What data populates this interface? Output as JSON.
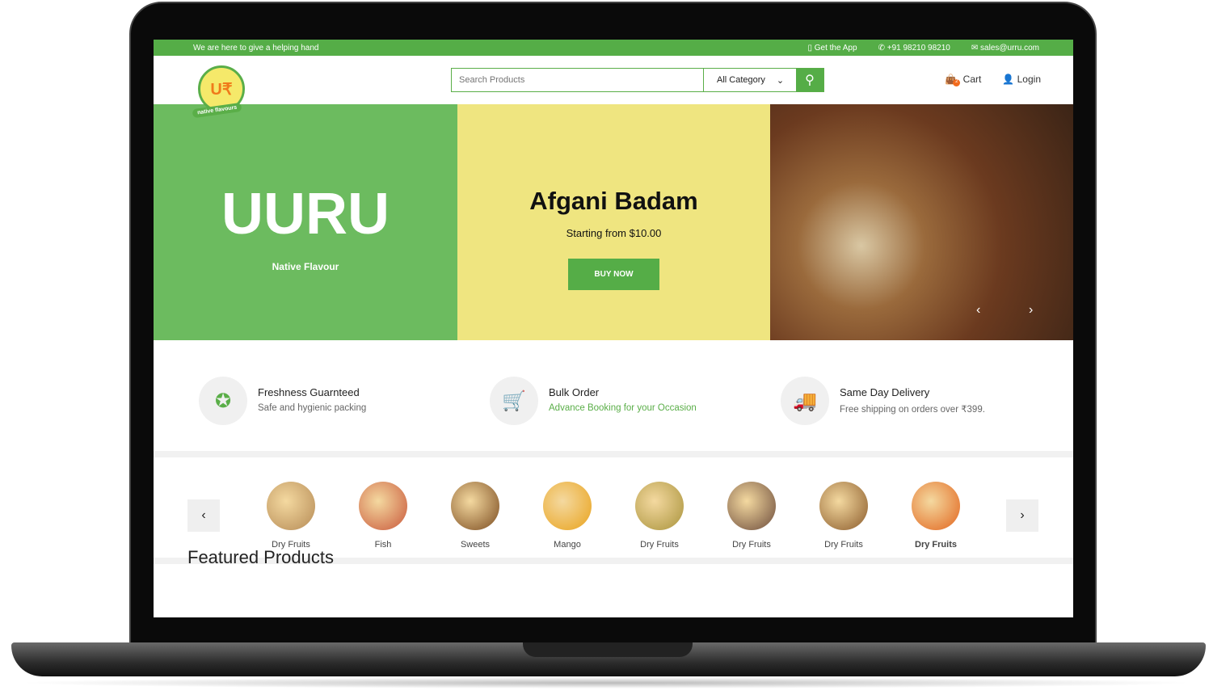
{
  "topbar": {
    "tagline": "We are here to give a helping hand",
    "app": "Get the App",
    "phone": "+91 98210 98210",
    "email": "sales@urru.com"
  },
  "header": {
    "logo_text": "U₹",
    "logo_tagline": "native flavours",
    "search_placeholder": "Search Products",
    "category": "All Category",
    "cart": "Cart",
    "cart_count": "2",
    "login": "Login"
  },
  "hero": {
    "brand": "UURU",
    "brand_sub": "Native Flavour",
    "title": "Afgani Badam",
    "subtitle": "Starting from  $10.00",
    "cta": "BUY NOW"
  },
  "features": [
    {
      "title": "Freshness Guarnteed",
      "desc": "Safe and hygienic packing"
    },
    {
      "title": "Bulk Order",
      "desc": "Advance Booking for your Occasion"
    },
    {
      "title": "Same Day Delivery",
      "desc": "Free shipping on orders over ₹399."
    }
  ],
  "categories": [
    {
      "label": "Dry Fruits",
      "color": "#b58a55"
    },
    {
      "label": "Fish",
      "color": "#c9573a"
    },
    {
      "label": "Sweets",
      "color": "#7a4a1e"
    },
    {
      "label": "Mango",
      "color": "#e9a21b"
    },
    {
      "label": "Dry Fruits",
      "color": "#a8923a"
    },
    {
      "label": "Dry Fruits",
      "color": "#6b4a3a"
    },
    {
      "label": "Dry Fruits",
      "color": "#8a5a2a"
    },
    {
      "label": "Dry Fruits",
      "color": "#e2641c"
    }
  ],
  "featured_title": "Featured Products"
}
